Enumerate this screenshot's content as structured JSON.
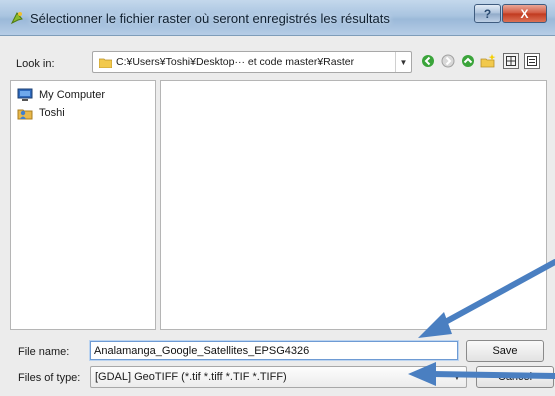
{
  "window": {
    "title": "Sélectionner le fichier raster où seront enregistrés les résultats",
    "help_label": "?",
    "close_label": "X"
  },
  "toolbar": {
    "look_in_label": "Look in:",
    "path": "C:¥Users¥Toshi¥Desktop··· et code master¥Raster",
    "icons": [
      "back-icon",
      "forward-icon",
      "parent-folder-icon",
      "new-folder-icon",
      "list-view-icon",
      "detail-view-icon"
    ]
  },
  "sidebar": {
    "items": [
      {
        "label": "My Computer",
        "icon": "computer-icon"
      },
      {
        "label": "Toshi",
        "icon": "user-folder-icon"
      }
    ]
  },
  "form": {
    "file_name_label": "File name:",
    "file_name_value": "Analamanga_Google_Satellites_EPSG4326",
    "save_label": "Save",
    "files_of_type_label": "Files of type:",
    "files_of_type_value": "[GDAL] GeoTIFF (*.tif *.tiff *.TIF *.TIFF)",
    "cancel_label": "Cancel"
  },
  "annotations": {
    "arrow_color": "#4a7fc1"
  }
}
